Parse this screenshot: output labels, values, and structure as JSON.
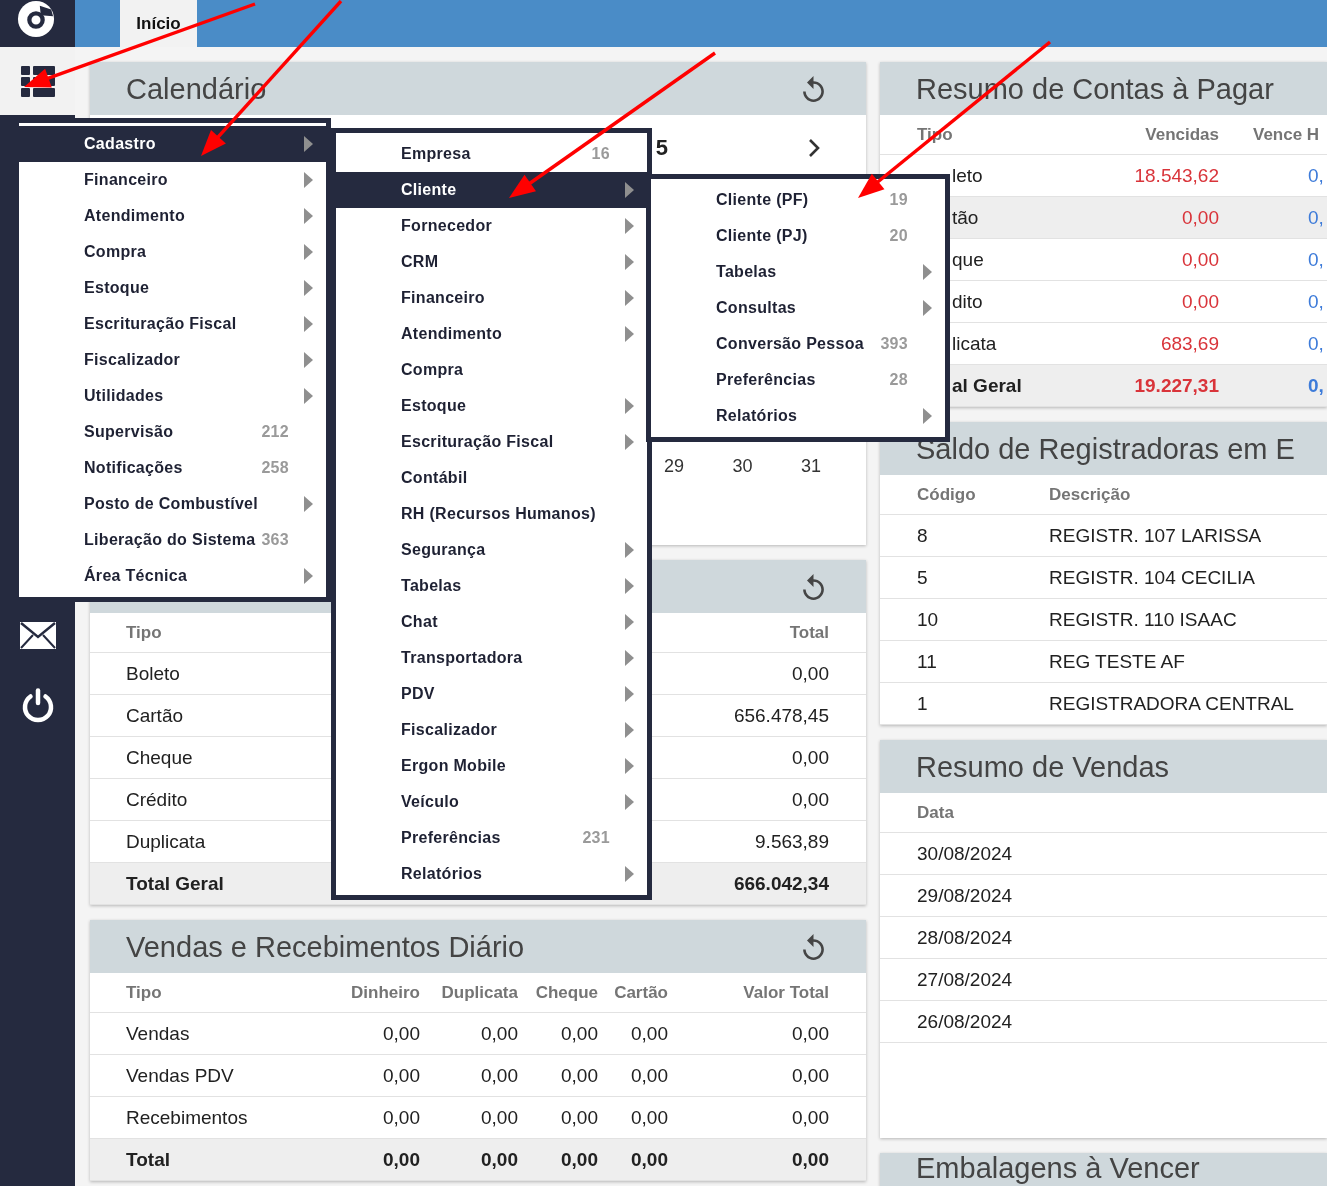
{
  "topbar": {
    "tabs": [
      {
        "label": "Início",
        "selected": true
      }
    ]
  },
  "sidebar": {
    "menu_button": {
      "expanded": true
    }
  },
  "main_menu": {
    "items": [
      {
        "label": "Cadastro",
        "selected": true,
        "has_submenu": true,
        "children": [
          {
            "label": "Empresa",
            "selected": false,
            "has_submenu": false,
            "count": "16"
          },
          {
            "label": "Cliente",
            "selected": true,
            "has_submenu": true,
            "children": [
              {
                "label": "Cliente (PF)",
                "selected": false,
                "has_submenu": false,
                "count": "19"
              },
              {
                "label": "Cliente (PJ)",
                "selected": false,
                "has_submenu": false,
                "count": "20"
              },
              {
                "label": "Tabelas",
                "selected": false,
                "has_submenu": true
              },
              {
                "label": "Consultas",
                "selected": false,
                "has_submenu": true
              },
              {
                "label": "Conversão Pessoa",
                "selected": false,
                "has_submenu": false,
                "count": "393"
              },
              {
                "label": "Preferências",
                "selected": false,
                "has_submenu": false,
                "count": "28"
              },
              {
                "label": "Relatórios",
                "selected": false,
                "has_submenu": true
              }
            ]
          },
          {
            "label": "Fornecedor",
            "selected": false,
            "has_submenu": true
          },
          {
            "label": "CRM",
            "selected": false,
            "has_submenu": true
          },
          {
            "label": "Financeiro",
            "selected": false,
            "has_submenu": true
          },
          {
            "label": "Atendimento",
            "selected": false,
            "has_submenu": true
          },
          {
            "label": "Compra",
            "selected": false,
            "has_submenu": false
          },
          {
            "label": "Estoque",
            "selected": false,
            "has_submenu": true
          },
          {
            "label": "Escrituração Fiscal",
            "selected": false,
            "has_submenu": true
          },
          {
            "label": "Contábil",
            "selected": false,
            "has_submenu": false
          },
          {
            "label": "RH (Recursos Humanos)",
            "selected": false,
            "has_submenu": false
          },
          {
            "label": "Segurança",
            "selected": false,
            "has_submenu": true
          },
          {
            "label": "Tabelas",
            "selected": false,
            "has_submenu": true
          },
          {
            "label": "Chat",
            "selected": false,
            "has_submenu": true
          },
          {
            "label": "Transportadora",
            "selected": false,
            "has_submenu": true
          },
          {
            "label": "PDV",
            "selected": false,
            "has_submenu": true
          },
          {
            "label": "Fiscalizador",
            "selected": false,
            "has_submenu": true
          },
          {
            "label": "Ergon Mobile",
            "selected": false,
            "has_submenu": true
          },
          {
            "label": "Veículo",
            "selected": false,
            "has_submenu": true
          },
          {
            "label": "Preferências",
            "selected": false,
            "has_submenu": false,
            "count": "231"
          },
          {
            "label": "Relatórios",
            "selected": false,
            "has_submenu": true
          }
        ]
      },
      {
        "label": "Financeiro",
        "selected": false,
        "has_submenu": true
      },
      {
        "label": "Atendimento",
        "selected": false,
        "has_submenu": true
      },
      {
        "label": "Compra",
        "selected": false,
        "has_submenu": true
      },
      {
        "label": "Estoque",
        "selected": false,
        "has_submenu": true
      },
      {
        "label": "Escrituração Fiscal",
        "selected": false,
        "has_submenu": true
      },
      {
        "label": "Fiscalizador",
        "selected": false,
        "has_submenu": true
      },
      {
        "label": "Utilidades",
        "selected": false,
        "has_submenu": true
      },
      {
        "label": "Supervisão",
        "selected": false,
        "has_submenu": false,
        "count": "212"
      },
      {
        "label": "Notificações",
        "selected": false,
        "has_submenu": false,
        "count": "258"
      },
      {
        "label": "Posto de Combustível",
        "selected": false,
        "has_submenu": true
      },
      {
        "label": "Liberação do Sistema",
        "selected": false,
        "has_submenu": false,
        "count": "363"
      },
      {
        "label": "Área Técnica",
        "selected": false,
        "has_submenu": true
      }
    ]
  },
  "calendar": {
    "title": "Calendário",
    "month_label": "5",
    "days": [
      "29",
      "30",
      "31"
    ]
  },
  "payment_type_totals": {
    "columns": [
      "Tipo",
      "Total"
    ],
    "rows": [
      [
        "Boleto",
        "0,00"
      ],
      [
        "Cartão",
        "656.478,45"
      ],
      [
        "Cheque",
        "0,00"
      ],
      [
        "Crédito",
        "0,00"
      ],
      [
        "Duplicata",
        "9.563,89"
      ]
    ],
    "total": [
      "Total Geral",
      "666.042,34"
    ]
  },
  "daily_sales": {
    "title": "Vendas e Recebimentos Diário",
    "columns": [
      "Tipo",
      "Dinheiro",
      "Duplicata",
      "Cheque",
      "Cartão",
      "Valor Total"
    ],
    "rows": [
      [
        "Vendas",
        "0,00",
        "0,00",
        "0,00",
        "0,00",
        "0,00"
      ],
      [
        "Vendas PDV",
        "0,00",
        "0,00",
        "0,00",
        "0,00",
        "0,00"
      ],
      [
        "Recebimentos",
        "0,00",
        "0,00",
        "0,00",
        "0,00",
        "0,00"
      ]
    ],
    "total": [
      "Total",
      "0,00",
      "0,00",
      "0,00",
      "0,00",
      "0,00"
    ]
  },
  "accounts_payable": {
    "title": "Resumo de Contas à Pagar",
    "columns": [
      {
        "label": "Tipo"
      },
      {
        "label": "Vencidas",
        "color": "#d9343a"
      },
      {
        "label": "Vence H",
        "color": "#3d7bd9"
      }
    ],
    "rows": [
      {
        "cells": [
          "leto",
          "18.543,62",
          "0,"
        ],
        "hovered": false
      },
      {
        "cells": [
          "tão",
          "0,00",
          "0,"
        ],
        "hovered": true
      },
      {
        "cells": [
          "que",
          "0,00",
          "0,"
        ],
        "hovered": false
      },
      {
        "cells": [
          "dito",
          "0,00",
          "0,"
        ],
        "hovered": false
      },
      {
        "cells": [
          "licata",
          "683,69",
          "0,"
        ],
        "hovered": false
      }
    ],
    "total": [
      "al Geral",
      "19.227,31",
      "0,"
    ]
  },
  "registers": {
    "title": "Saldo de Registradoras em E",
    "columns": [
      "Código",
      "Descrição"
    ],
    "rows": [
      [
        "8",
        "REGISTR. 107 LARISSA"
      ],
      [
        "5",
        "REGISTR. 104 CECILIA"
      ],
      [
        "10",
        "REGISTR. 110 ISAAC"
      ],
      [
        "11",
        "REG TESTE AF"
      ],
      [
        "1",
        "REGISTRADORA CENTRAL"
      ]
    ]
  },
  "sales_summary": {
    "title": "Resumo de Vendas",
    "columns": [
      "Data"
    ],
    "rows": [
      [
        "30/08/2024"
      ],
      [
        "29/08/2024"
      ],
      [
        "28/08/2024"
      ],
      [
        "27/08/2024"
      ],
      [
        "26/08/2024"
      ]
    ]
  },
  "expiring_packages": {
    "title": "Embalagens à Vencer"
  }
}
